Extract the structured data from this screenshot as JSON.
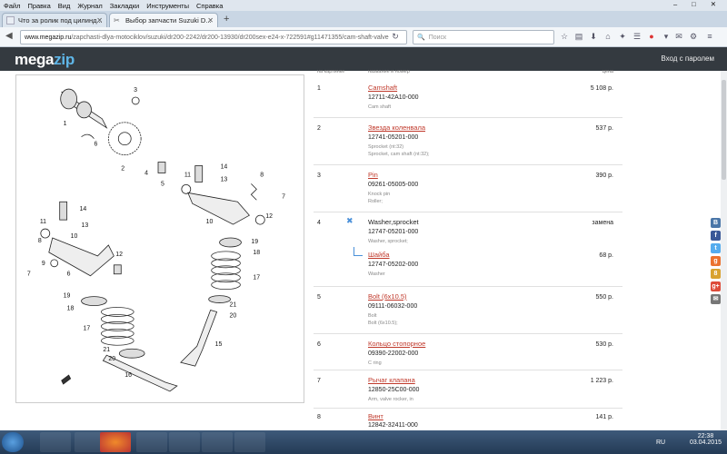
{
  "menu": [
    "Файл",
    "Правка",
    "Вид",
    "Журнал",
    "Закладки",
    "Инструменты",
    "Справка"
  ],
  "tabs": [
    {
      "label": "Что за ролик под цилинд..."
    },
    {
      "label": "Выбор запчасти Suzuki D..."
    }
  ],
  "url": {
    "host": "www.megazip.ru",
    "path": "/zapchasti-dlya-motociklov/suzuki/dr200-2242/dr200-13930/dr200sex-e24-x-722591#g11471355/cam-shaft-valve"
  },
  "search_placeholder": "Поиск",
  "site": {
    "logo_a": "mega",
    "logo_b": "zip",
    "login": "Вход с паролем"
  },
  "columns": {
    "num": "на картинке",
    "name": "название и номер",
    "price": "цена"
  },
  "parts": [
    {
      "num": "1",
      "name": "Camshaft",
      "code": "12711-42A10-000",
      "desc": "Cam shaft",
      "desc2": "",
      "price": "5 108 р."
    },
    {
      "num": "2",
      "name": "Звезда коленвала",
      "code": "12741-05201-000",
      "desc": "Sprocket (nt:32)",
      "desc2": "Sprocket, cam shaft (nt:32);",
      "price": "537 р."
    },
    {
      "num": "3",
      "name": "Pin",
      "code": "09261-05005-000",
      "desc": "Knock pin",
      "desc2": "Roller;",
      "price": "390 р."
    },
    {
      "num": "4",
      "name": "Washer,sprocket",
      "code": "12747-05201-000",
      "desc": "Washer, sprocket;",
      "desc2": "",
      "price": "замена"
    },
    {
      "num": "",
      "name": "Шайба",
      "code": "12747-05202-000",
      "desc": "Washer",
      "desc2": "",
      "price": "68 р."
    },
    {
      "num": "5",
      "name": "Bolt (6x10.5)",
      "code": "09111-06032-000",
      "desc": "Bolt",
      "desc2": "Bolt (6x10.5);",
      "price": "550 р."
    },
    {
      "num": "6",
      "name": "Кольцо стопорное",
      "code": "09390-22002-000",
      "desc": "C ring",
      "desc2": "",
      "price": "530 р."
    },
    {
      "num": "7",
      "name": "Рычаг клапана",
      "code": "12850-25C00-000",
      "desc": "Arm, valve rocker, in",
      "desc2": "",
      "price": "1 223 р."
    },
    {
      "num": "8",
      "name": "Винт",
      "code": "12842-32411-000",
      "desc": "",
      "desc2": "",
      "price": "141 р."
    }
  ],
  "diagram_labels": [
    "1",
    "2",
    "3",
    "4",
    "5",
    "6",
    "7",
    "8",
    "9",
    "10",
    "11",
    "12",
    "13",
    "14",
    "15",
    "16",
    "17",
    "18",
    "19",
    "20",
    "21"
  ],
  "social": [
    "В",
    "f",
    "t",
    "g",
    "8",
    "g+",
    "✉"
  ],
  "tray": {
    "lang": "RU",
    "time": "22:38",
    "date": "03.04.2015"
  }
}
